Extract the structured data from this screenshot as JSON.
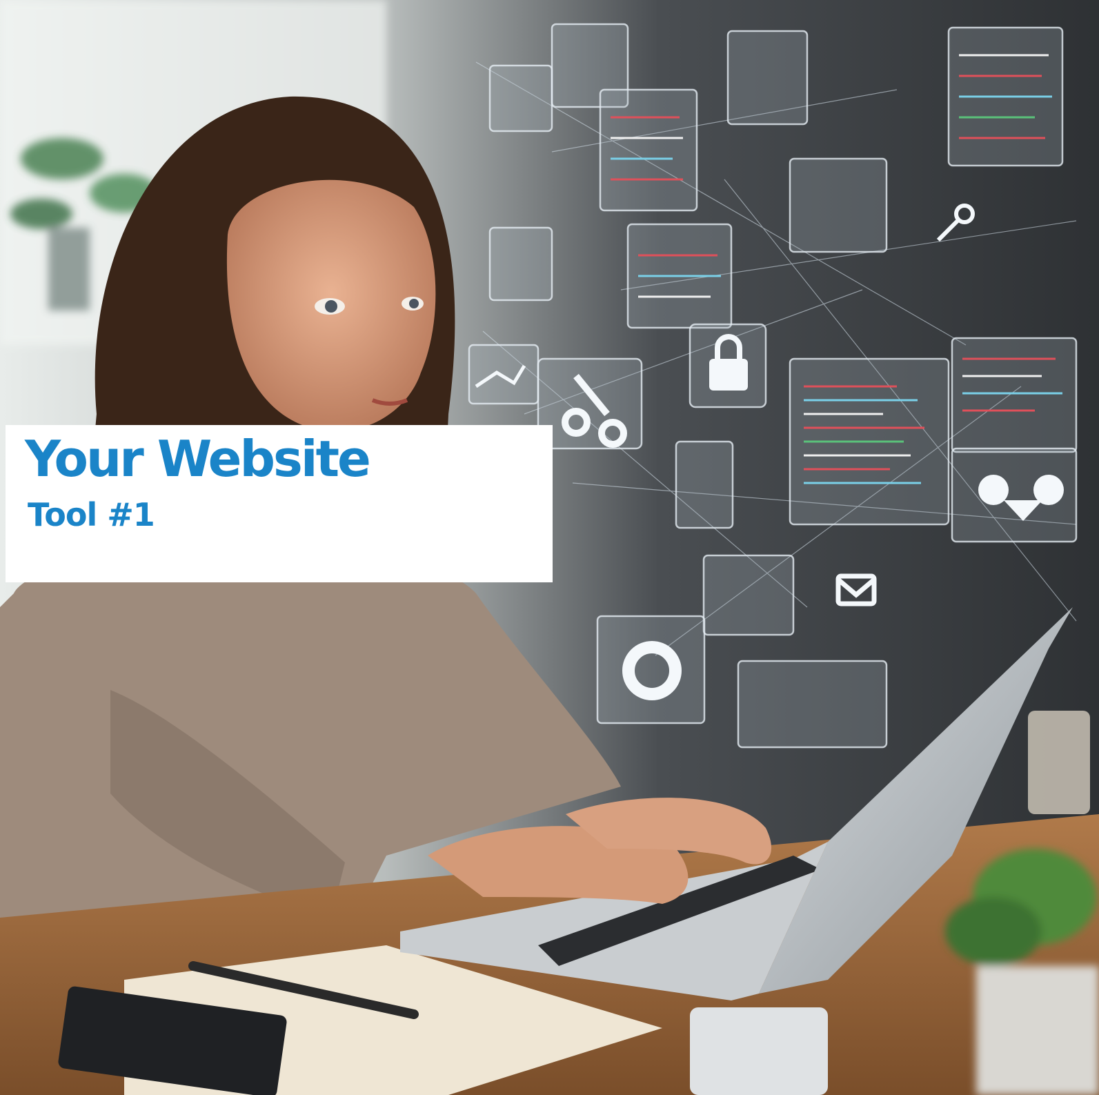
{
  "title_card": {
    "headline": "Your Website",
    "subline": "Tool #1"
  },
  "colors": {
    "headline": "#1a84c8",
    "card_background": "#ffffff"
  },
  "scene": {
    "description_icons": [
      "lock-icon",
      "key-icon",
      "gear-icon",
      "mail-icon",
      "chart-icon",
      "chat-icon",
      "heart-lock-icon"
    ]
  }
}
